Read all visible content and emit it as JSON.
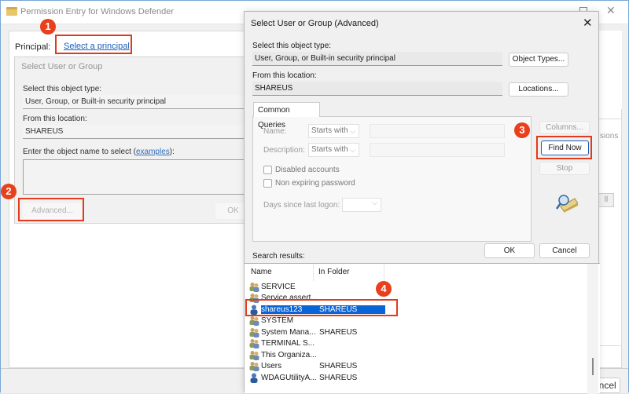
{
  "back_window": {
    "title": "Permission Entry for Windows Defender",
    "principal_label": "Principal:",
    "principal_link": "Select a principal",
    "right_panel_fragment": "sions",
    "right_button_fragment": "ll",
    "ok_fragment": "OK",
    "cancel_label": "Cancel"
  },
  "select_dialog": {
    "title": "Select User or Group",
    "object_type_label": "Select this object type:",
    "object_type_value": "User, Group, or Built-in security principal",
    "location_label": "From this location:",
    "location_value": "SHAREUS",
    "enter_name_label": "Enter the object name to select (",
    "examples_link": "examples",
    "enter_name_suffix": "):",
    "advanced_button": "Advanced...",
    "ok_button": "OK"
  },
  "advanced_dialog": {
    "title": "Select User or Group (Advanced)",
    "object_type_label": "Select this object type:",
    "object_type_value": "User, Group, or Built-in security principal",
    "object_types_button": "Object Types...",
    "location_label": "From this location:",
    "location_value": "SHAREUS",
    "locations_button": "Locations...",
    "common_queries_tab": "Common Queries",
    "name_label": "Name:",
    "name_operator": "Starts with",
    "description_label": "Description:",
    "description_operator": "Starts with",
    "disabled_accounts": "Disabled accounts",
    "non_expiring_password": "Non expiring password",
    "days_since_logon_label": "Days since last logon:",
    "columns_button": "Columns...",
    "find_now_button": "Find Now",
    "stop_button": "Stop",
    "ok_button": "OK",
    "cancel_button": "Cancel",
    "search_results_label": "Search results:",
    "columns": [
      "Name",
      "In Folder"
    ],
    "results": [
      {
        "name": "SERVICE",
        "folder": "",
        "icon": "group-icon"
      },
      {
        "name": "Service assert...",
        "folder": "",
        "icon": "group-icon"
      },
      {
        "name": "shareus123",
        "folder": "SHAREUS",
        "icon": "user-icon",
        "selected": true
      },
      {
        "name": "SYSTEM",
        "folder": "",
        "icon": "group-icon"
      },
      {
        "name": "System Mana...",
        "folder": "SHAREUS",
        "icon": "group-icon"
      },
      {
        "name": "TERMINAL S...",
        "folder": "",
        "icon": "group-icon"
      },
      {
        "name": "This Organiza...",
        "folder": "",
        "icon": "group-icon"
      },
      {
        "name": "Users",
        "folder": "SHAREUS",
        "icon": "group-icon"
      },
      {
        "name": "WDAGUtilityA...",
        "folder": "SHAREUS",
        "icon": "user-icon"
      }
    ]
  },
  "annotations": {
    "step1": "1",
    "step2": "2",
    "step3": "3",
    "step4": "4",
    "highlight_color": "#e23a1a"
  }
}
